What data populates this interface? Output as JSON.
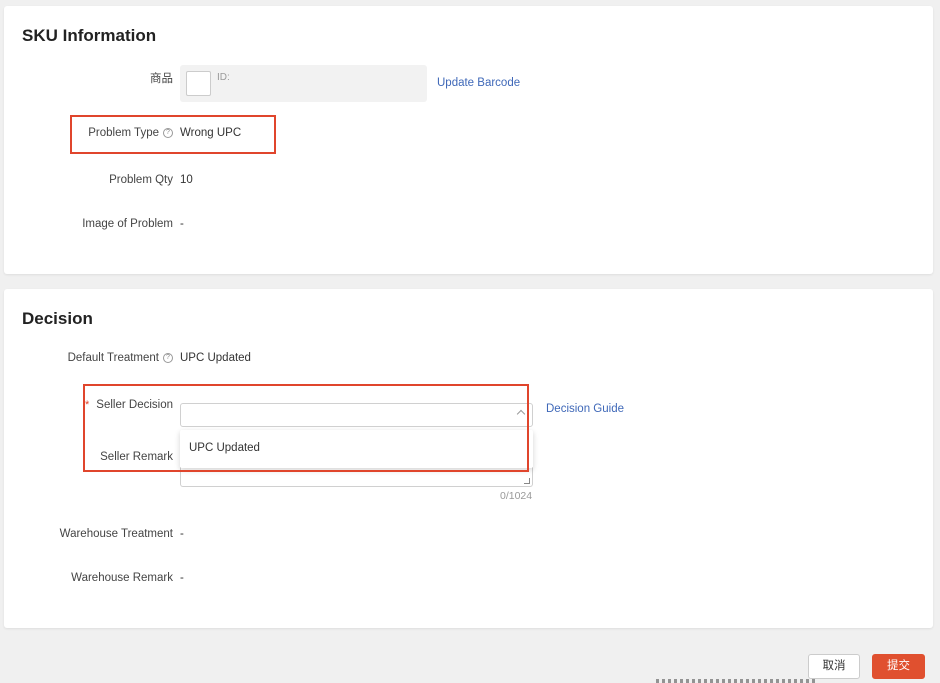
{
  "sku_section": {
    "title": "SKU Information",
    "product_label": "商品",
    "product_id_label": "ID:",
    "update_barcode_link": "Update Barcode",
    "problem_type_label": "Problem Type",
    "problem_type_value": "Wrong UPC",
    "problem_qty_label": "Problem Qty",
    "problem_qty_value": "10",
    "image_label": "Image of Problem",
    "image_value": "-"
  },
  "decision_section": {
    "title": "Decision",
    "default_treatment_label": "Default Treatment",
    "default_treatment_value": "UPC Updated",
    "seller_decision_required": "*",
    "seller_decision_label": "Seller Decision",
    "seller_decision_value": "",
    "decision_guide_link": "Decision Guide",
    "dropdown_options": [
      "UPC Updated"
    ],
    "seller_remark_label": "Seller Remark",
    "seller_remark_counter": "0/1024",
    "warehouse_treatment_label": "Warehouse Treatment",
    "warehouse_treatment_value": "-",
    "warehouse_remark_label": "Warehouse Remark",
    "warehouse_remark_value": "-"
  },
  "footer": {
    "cancel_label": "取消",
    "submit_label": "提交"
  },
  "colors": {
    "accent": "#e0502f",
    "link": "#3f68b8",
    "highlight": "#e0452c"
  }
}
